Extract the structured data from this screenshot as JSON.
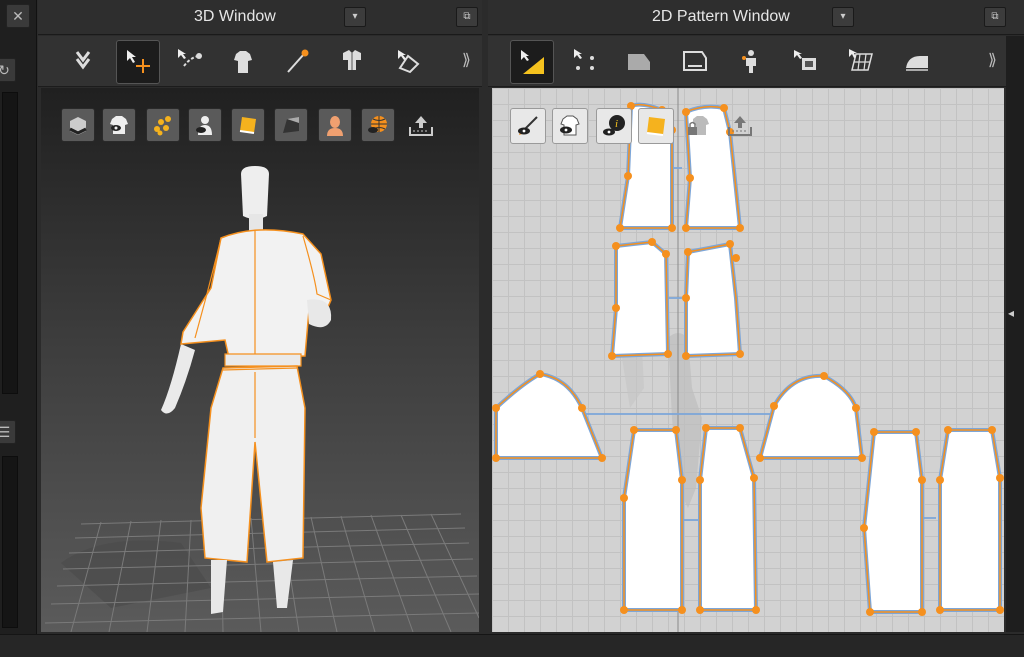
{
  "windows": {
    "window_3d": {
      "title": "3D Window"
    },
    "window_2d": {
      "title": "2D Pattern Window"
    }
  },
  "icons": {
    "left_strip": [
      "close-icon",
      "undo-icon",
      "list-icon"
    ],
    "toolbar_3d": [
      "simulation-icon",
      "select-move-icon",
      "edit-sewing-icon",
      "avatar-garment-icon",
      "tack-icon",
      "arrangement-icon",
      "edit-texture-icon",
      "more-tools-icon"
    ],
    "toolbar_2d": [
      "edit-pattern-icon",
      "points-icon",
      "polygon-icon",
      "rectangle-icon",
      "internal-line-icon",
      "segment-sewing-icon",
      "grid-texture-icon",
      "iron-icon",
      "more-tools-icon"
    ],
    "view3d_display": [
      "show-3d-box-icon",
      "show-garment-icon",
      "show-pins-icon",
      "show-avatar-icon",
      "show-texture-icon",
      "show-wireframe-icon",
      "show-skin-icon",
      "show-world-icon",
      "export-icon"
    ],
    "view2d_display": [
      "show-pattern-outline-icon",
      "show-garment-2d-icon",
      "pattern-info-icon",
      "show-fabric-icon",
      "lock-pattern-icon",
      "export-pattern-icon"
    ]
  },
  "colors": {
    "accent_orange": "#f5901e",
    "pattern_outline": "#7da6d8",
    "grid_3d": "#7a7a7a"
  }
}
